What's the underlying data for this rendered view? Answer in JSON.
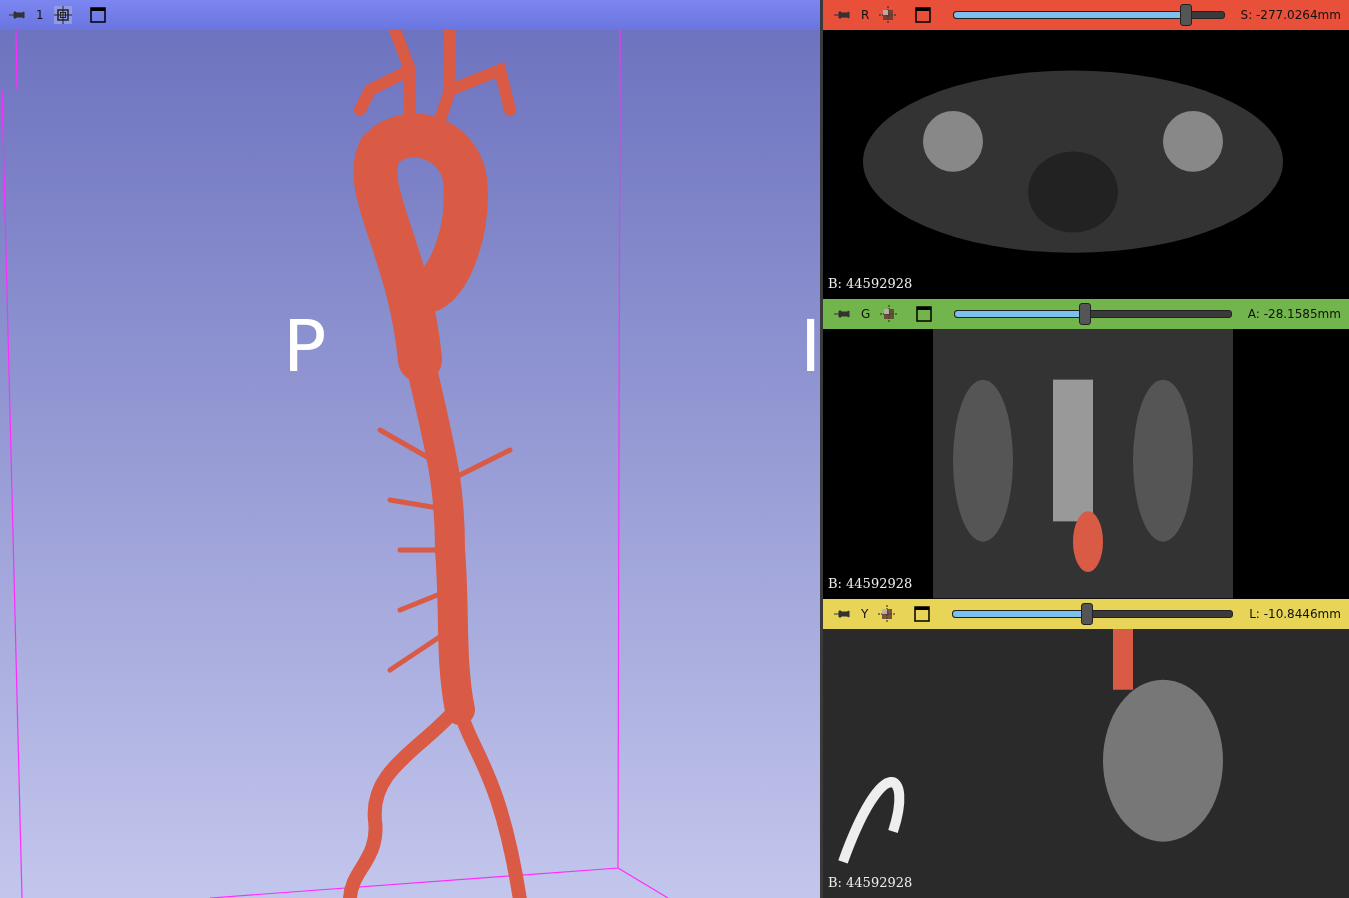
{
  "view3d": {
    "view_label": "1",
    "left_label": "P",
    "right_label": "I"
  },
  "slice_views": [
    {
      "color": "#e8503a",
      "letter": "R",
      "level": 0.86,
      "offset": "S: -277.0264mm",
      "annotation": "B: 44592928",
      "kind": "axial"
    },
    {
      "color": "#72b54c",
      "letter": "G",
      "level": 0.47,
      "offset": "A: -28.1585mm",
      "annotation": "B: 44592928",
      "kind": "coronal"
    },
    {
      "color": "#e8d456",
      "letter": "Y",
      "level": 0.48,
      "offset": "L: -10.8446mm",
      "annotation": "B: 44592928",
      "kind": "sagittal"
    }
  ]
}
